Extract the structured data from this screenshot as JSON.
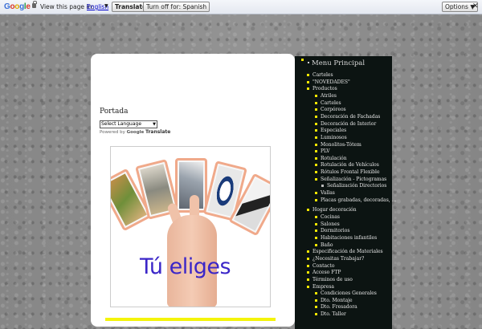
{
  "translate_bar": {
    "logo": "Google",
    "prompt": "View this page in:",
    "language": "English",
    "translate_button": "Translate",
    "turn_off_button": "Turn off for: Spanish",
    "options_button": "Options ▼",
    "close": "✕"
  },
  "main": {
    "section_title": "Portada",
    "language_select": "Select Language",
    "powered_by": "Powered by",
    "powered_google": "Google",
    "powered_translate": "Translate",
    "banner_text": "Tú eliges"
  },
  "sidebar": {
    "title": "Menu Principal",
    "items": [
      {
        "label": "Carteles",
        "level": 0
      },
      {
        "label": "\"NOVEDADES\"",
        "level": 0
      },
      {
        "label": "Productos",
        "level": 0
      },
      {
        "label": "Atriles",
        "level": 1
      },
      {
        "label": "Carteles",
        "level": 1
      },
      {
        "label": "Corpóreos",
        "level": 1
      },
      {
        "label": "Decoración de Fachadas",
        "level": 1
      },
      {
        "label": "Decoración de Interior",
        "level": 1
      },
      {
        "label": "Especiales",
        "level": 1
      },
      {
        "label": "Luminosos",
        "level": 1
      },
      {
        "label": "Monolitos-Tótem",
        "level": 1
      },
      {
        "label": "PLV",
        "level": 1
      },
      {
        "label": "Rotulación",
        "level": 1
      },
      {
        "label": "Rotulación de Vehículos",
        "level": 1
      },
      {
        "label": "Rótulos Frontal Flexible",
        "level": 1
      },
      {
        "label": "Señalización - Pictogramas",
        "level": 1
      },
      {
        "label": "Señalización Directorios",
        "level": 2
      },
      {
        "label": "Vallas",
        "level": 1
      },
      {
        "label": "Placas grabadas, decoradas, ...",
        "level": 1
      },
      {
        "label": "Hogar decoración",
        "level": 0
      },
      {
        "label": "Cocinas",
        "level": 1
      },
      {
        "label": "Salones",
        "level": 1
      },
      {
        "label": "Dormitorios",
        "level": 1
      },
      {
        "label": "Habitaciones infantiles",
        "level": 1
      },
      {
        "label": "Baño",
        "level": 1
      },
      {
        "label": "Especificación de Materiales",
        "level": 0
      },
      {
        "label": "¿Necesitas Trabajar?",
        "level": 0
      },
      {
        "label": "Contacto",
        "level": 0
      },
      {
        "label": "Acceso FTP",
        "level": 0
      },
      {
        "label": "Términos de uso",
        "level": 0
      },
      {
        "label": "Empresa",
        "level": 0
      },
      {
        "label": "Condiciones Generales",
        "level": 1
      },
      {
        "label": "Dto. Montaje",
        "level": 1
      },
      {
        "label": "Dto. Fresadora",
        "level": 1
      },
      {
        "label": "Dto. Taller",
        "level": 1
      }
    ]
  },
  "colors": {
    "accent_yellow": "#f4e600",
    "sidebar_bg": "#0c1412",
    "banner_text": "#3b26c8",
    "card_border": "#f0a98a"
  }
}
